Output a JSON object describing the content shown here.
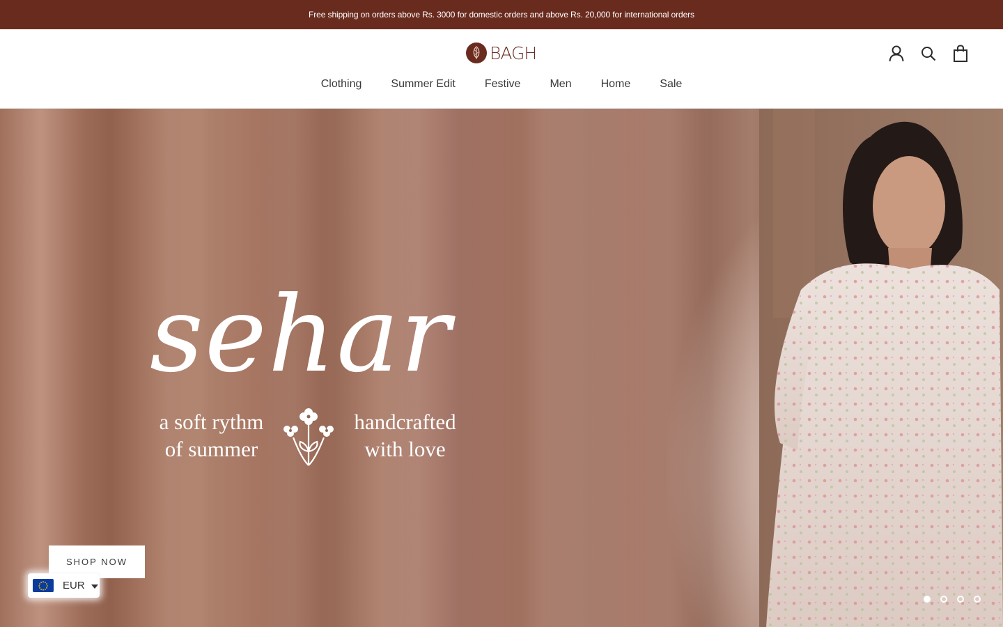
{
  "announcement": {
    "text": "Free shipping on orders above Rs. 3000 for domestic orders and above Rs. 20,000 for international orders"
  },
  "brand": {
    "name": "BAGH",
    "color": "#6a2b1f"
  },
  "header": {
    "icons": [
      "account-icon",
      "search-icon",
      "cart-icon"
    ]
  },
  "nav": {
    "items": [
      {
        "label": "Clothing"
      },
      {
        "label": "Summer Edit"
      },
      {
        "label": "Festive"
      },
      {
        "label": "Men"
      },
      {
        "label": "Home"
      },
      {
        "label": "Sale"
      }
    ]
  },
  "hero": {
    "script_title": "sehar",
    "tagline_left": "a soft rythm of summer",
    "tagline_right": "handcrafted with love",
    "cta_label": "SHOP NOW",
    "slides_total": 4,
    "active_slide": 1
  },
  "currency": {
    "code": "EUR",
    "flag": "eu-flag-icon"
  }
}
